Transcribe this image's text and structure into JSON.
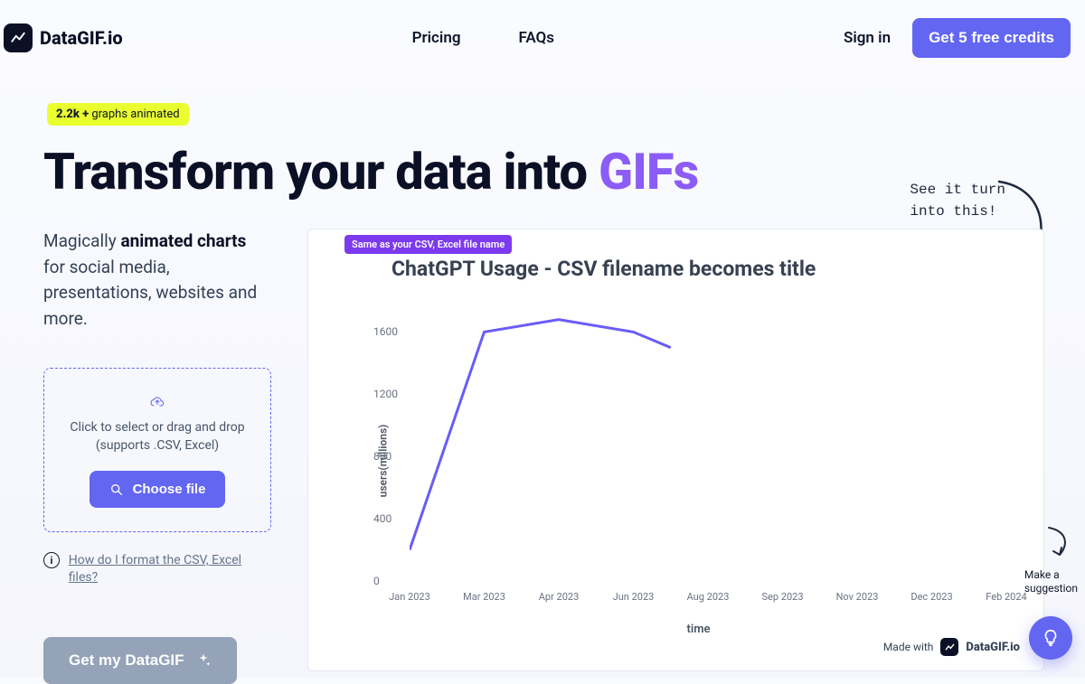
{
  "header": {
    "brand": "DataGIF.io",
    "nav": {
      "pricing": "Pricing",
      "faqs": "FAQs"
    },
    "signin": "Sign in",
    "cta": "Get 5 free credits"
  },
  "hero": {
    "badge_count": "2.2k +",
    "badge_suffix": " graphs animated",
    "title_pre": "Transform your data into ",
    "title_gifs": "GIFs",
    "subhead_pre": "Magically ",
    "subhead_bold": "animated charts",
    "subhead_post": " for social media, presentations, websites and more."
  },
  "upload": {
    "droptext": "Click to select or drag and drop (supports .CSV, Excel)",
    "choose": "Choose file",
    "help": "How do I format the CSV, Excel files?"
  },
  "getbtn": "Get my DataGIF",
  "preview": {
    "see_note_line1": "See it turn",
    "see_note_line2": "into this!",
    "filename_badge": "Same as your CSV, Excel file name",
    "made_with": "Made with",
    "made_brand": "DataGIF.io"
  },
  "chart_data": {
    "type": "line",
    "title": "ChatGPT Usage - CSV filename becomes title",
    "xlabel": "time",
    "ylabel": "users(millions)",
    "y_ticks": [
      0,
      400,
      800,
      1200,
      1600
    ],
    "x_ticks": [
      "Jan 2023",
      "Mar 2023",
      "Apr 2023",
      "Jun 2023",
      "Aug 2023",
      "Sep 2023",
      "Nov 2023",
      "Dec 2023",
      "Feb 2024"
    ],
    "series": [
      {
        "name": "users",
        "points": [
          {
            "x": "Jan 2023",
            "y": 200
          },
          {
            "x": "Mar 2023",
            "y": 1600
          },
          {
            "x": "Apr 2023",
            "y": 1680
          },
          {
            "x": "Jun 2023",
            "y": 1600
          },
          {
            "x": "Jul 2023",
            "y": 1500
          }
        ]
      }
    ],
    "x_domain_count": 9,
    "ylim": [
      0,
      1800
    ]
  },
  "suggest": {
    "line1": "Make a",
    "line2": "suggestion"
  }
}
